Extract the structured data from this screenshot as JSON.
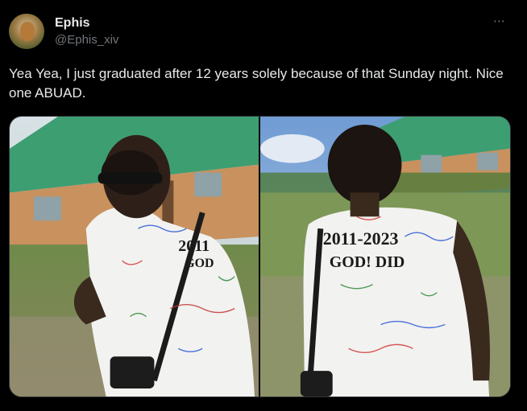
{
  "author": {
    "display_name": "Ephis",
    "handle": "@Ephis_xiv",
    "avatar_icon": "avatar-photo"
  },
  "more_icon": "⋯",
  "tweet": {
    "text": "Yea Yea, I just graduated after 12 years solely because of that Sunday night. Nice one ABUAD."
  },
  "media": {
    "photos": [
      {
        "shirt_text_1": "2011",
        "shirt_text_2": "GOD"
      },
      {
        "shirt_text_1": "2011-2023",
        "shirt_text_2": "GOD! DID"
      }
    ]
  },
  "colors": {
    "background": "#000000",
    "text": "#e7e9ea",
    "muted": "#71767b",
    "border": "#2f3336"
  }
}
